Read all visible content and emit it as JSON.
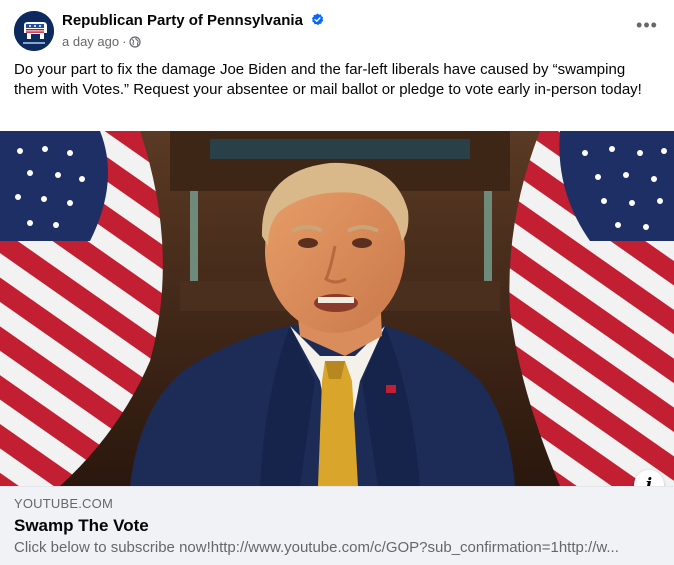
{
  "post": {
    "page_name": "Republican Party of Pennsylvania",
    "verified": true,
    "timestamp": "a day ago",
    "privacy_icon": "globe-icon",
    "more_icon": "more-options-icon",
    "more_label": "•••",
    "caption": "Do your part to fix the damage Joe Biden and the far-left liberals have caused by “swamping them with Votes.”  Request your absentee or mail ballot or pledge to vote early in-person today!"
  },
  "link_preview": {
    "domain": "YOUTUBE.COM",
    "title": "Swamp The Vote",
    "description": "Click below to subscribe now!http://www.youtube.com/c/GOP?sub_confirmation=1http://w...",
    "info_icon": "info-icon",
    "info_label": "i"
  },
  "colors": {
    "verified_blue": "#0866ff",
    "secondary_text": "#65676b",
    "card_bg": "#f0f2f5",
    "suit_navy": "#1d2b57",
    "tie_gold": "#d9a52b"
  }
}
